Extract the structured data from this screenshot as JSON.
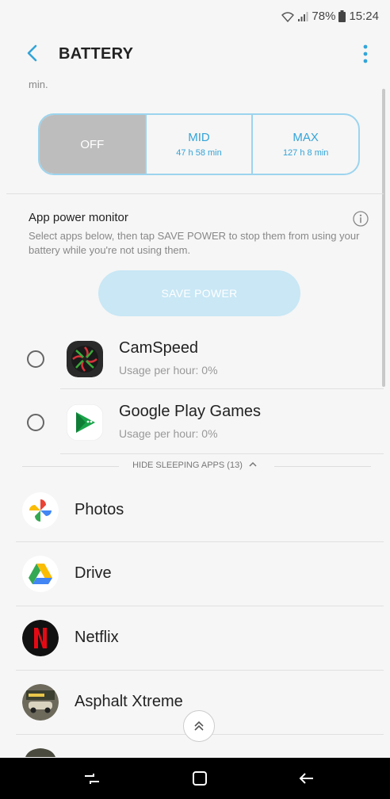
{
  "status": {
    "battery": "78%",
    "time": "15:24"
  },
  "appbar": {
    "title": "BATTERY"
  },
  "clipped_text": "min.",
  "power_mode": {
    "options": [
      {
        "label": "OFF",
        "sub": ""
      },
      {
        "label": "MID",
        "sub": "47 h 58 min"
      },
      {
        "label": "MAX",
        "sub": "127 h 8 min"
      }
    ],
    "selected": "OFF"
  },
  "app_power_monitor": {
    "title": "App power monitor",
    "description": "Select apps below, then tap SAVE POWER to stop them from using your battery while you're not using them.",
    "save_button": "SAVE POWER"
  },
  "apps": [
    {
      "name": "CamSpeed",
      "usage": "Usage per hour: 0%",
      "icon": "camspeed-icon"
    },
    {
      "name": "Google Play Games",
      "usage": "Usage per hour: 0%",
      "icon": "play-games-icon"
    }
  ],
  "hide_sleeping": "HIDE SLEEPING APPS (13)",
  "sleeping_apps": [
    {
      "name": "Photos",
      "icon": "photos-icon"
    },
    {
      "name": "Drive",
      "icon": "drive-icon"
    },
    {
      "name": "Netflix",
      "icon": "netflix-icon"
    },
    {
      "name": "Asphalt Xtreme",
      "icon": "asphalt-icon"
    }
  ],
  "colors": {
    "accent": "#33a4d8",
    "selected_bg": "#bdbdbd",
    "save_btn": "#c9e7f5"
  }
}
